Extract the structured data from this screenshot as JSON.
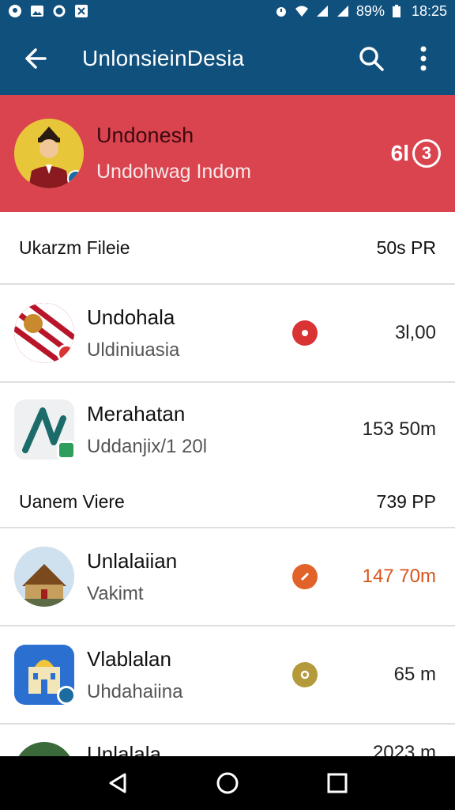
{
  "status_bar": {
    "battery": "89%",
    "time": "18:25"
  },
  "app_bar": {
    "title": "UnlonsieinDesia"
  },
  "profile": {
    "name": "Undonesh",
    "subtitle": "Undohwag Indom",
    "count": "6l",
    "count_badge": "3"
  },
  "list": {
    "header_row": {
      "label": "Ukarzm Fileie",
      "value": "50s PR"
    },
    "items": [
      {
        "title": "Undohala",
        "subtitle": "Uldiniuasia",
        "value": "3l,00",
        "accent": "#d93333"
      },
      {
        "title": "Merahatan",
        "subtitle": "Uddanjix/1 20l",
        "value": "153 50m"
      },
      {
        "title": "Unlalaiian",
        "subtitle": "Vakimt",
        "value": "147 70m",
        "accent": "#e2632a"
      },
      {
        "title": "Vlablalan",
        "subtitle": "Uhdahaiina",
        "value": "65 m",
        "accent": "#b49a3b"
      }
    ],
    "group_footer": {
      "label": "Uanem Viere",
      "value": "739 PP"
    },
    "partial_item": {
      "title": "Unlalala",
      "value": "2023 m"
    }
  },
  "colors": {
    "primary": "#10507c",
    "profile_bg": "#d9444f",
    "list_bg": "#f5f5f6"
  },
  "icons": {
    "back": "arrow-left-icon",
    "search": "search-icon",
    "more": "more-vert-icon",
    "nav_back": "triangle-back-icon",
    "nav_home": "circle-home-icon",
    "nav_recents": "square-recents-icon"
  }
}
